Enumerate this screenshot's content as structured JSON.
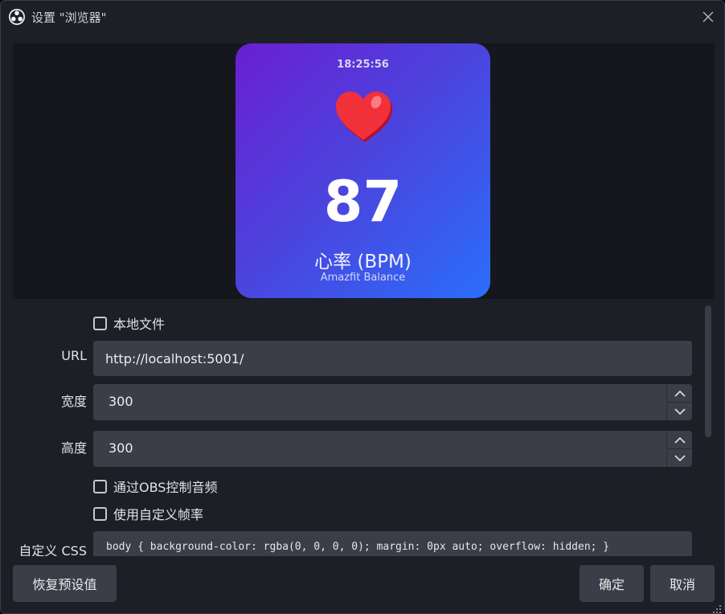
{
  "window": {
    "title": "设置 \"浏览器\""
  },
  "preview": {
    "time": "18:25:56",
    "bpm": "87",
    "label": "心率 (BPM)",
    "device": "Amazfit Balance"
  },
  "form": {
    "local_file_label": "本地文件",
    "url_label": "URL",
    "url_value": "http://localhost:5001/",
    "width_label": "宽度",
    "width_value": "300",
    "height_label": "高度",
    "height_value": "300",
    "obs_audio_label": "通过OBS控制音频",
    "custom_fps_label": "使用自定义帧率",
    "custom_css_label": "自定义 CSS",
    "custom_css_value": "body { background-color: rgba(0, 0, 0, 0); margin: 0px auto; overflow: hidden; }"
  },
  "buttons": {
    "restore_defaults": "恢复预设值",
    "ok": "确定",
    "cancel": "取消"
  },
  "colors": {
    "card_gradient_start": "#6a1fd1",
    "card_gradient_end": "#2a6ef9",
    "heart": "#f0313a"
  }
}
